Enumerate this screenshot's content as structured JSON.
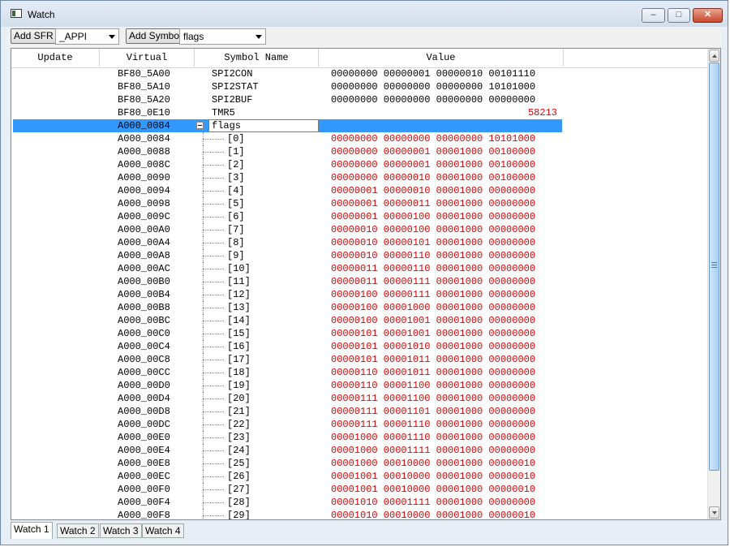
{
  "window": {
    "title": "Watch"
  },
  "toolbar": {
    "add_sfr_label": "Add SFR",
    "sfr_combo_value": "_APPI",
    "add_symbol_label": "Add Symbol",
    "symbol_combo_value": "flags"
  },
  "columns": [
    "Update",
    "Virtual",
    "Symbol Name",
    "Value"
  ],
  "sfr_rows": [
    {
      "virtual": "BF80_5A00",
      "symbol": "SPI2CON",
      "value": "00000000 00000001 00000010 00101110"
    },
    {
      "virtual": "BF80_5A10",
      "symbol": "SPI2STAT",
      "value": "00000000 00000000 00000000 10101000"
    },
    {
      "virtual": "BF80_5A20",
      "symbol": "SPI2BUF",
      "value": "00000000 00000000 00000000 00000000"
    },
    {
      "virtual": "BF80_0E10",
      "symbol": "TMR5",
      "value": "58213"
    }
  ],
  "selected_row": {
    "virtual": "A000_0084",
    "symbol": "flags",
    "value": ""
  },
  "array_rows": [
    {
      "virtual": "A000_0084",
      "index": "[0]",
      "value": "00000000 00000000 00000000 10101000"
    },
    {
      "virtual": "A000_0088",
      "index": "[1]",
      "value": "00000000 00000001 00001000 00100000"
    },
    {
      "virtual": "A000_008C",
      "index": "[2]",
      "value": "00000000 00000001 00001000 00100000"
    },
    {
      "virtual": "A000_0090",
      "index": "[3]",
      "value": "00000000 00000010 00001000 00100000"
    },
    {
      "virtual": "A000_0094",
      "index": "[4]",
      "value": "00000001 00000010 00001000 00000000"
    },
    {
      "virtual": "A000_0098",
      "index": "[5]",
      "value": "00000001 00000011 00001000 00000000"
    },
    {
      "virtual": "A000_009C",
      "index": "[6]",
      "value": "00000001 00000100 00001000 00000000"
    },
    {
      "virtual": "A000_00A0",
      "index": "[7]",
      "value": "00000010 00000100 00001000 00000000"
    },
    {
      "virtual": "A000_00A4",
      "index": "[8]",
      "value": "00000010 00000101 00001000 00000000"
    },
    {
      "virtual": "A000_00A8",
      "index": "[9]",
      "value": "00000010 00000110 00001000 00000000"
    },
    {
      "virtual": "A000_00AC",
      "index": "[10]",
      "value": "00000011 00000110 00001000 00000000"
    },
    {
      "virtual": "A000_00B0",
      "index": "[11]",
      "value": "00000011 00000111 00001000 00000000"
    },
    {
      "virtual": "A000_00B4",
      "index": "[12]",
      "value": "00000100 00000111 00001000 00000000"
    },
    {
      "virtual": "A000_00B8",
      "index": "[13]",
      "value": "00000100 00001000 00001000 00000000"
    },
    {
      "virtual": "A000_00BC",
      "index": "[14]",
      "value": "00000100 00001001 00001000 00000000"
    },
    {
      "virtual": "A000_00C0",
      "index": "[15]",
      "value": "00000101 00001001 00001000 00000000"
    },
    {
      "virtual": "A000_00C4",
      "index": "[16]",
      "value": "00000101 00001010 00001000 00000000"
    },
    {
      "virtual": "A000_00C8",
      "index": "[17]",
      "value": "00000101 00001011 00001000 00000000"
    },
    {
      "virtual": "A000_00CC",
      "index": "[18]",
      "value": "00000110 00001011 00001000 00000000"
    },
    {
      "virtual": "A000_00D0",
      "index": "[19]",
      "value": "00000110 00001100 00001000 00000000"
    },
    {
      "virtual": "A000_00D4",
      "index": "[20]",
      "value": "00000111 00001100 00001000 00000000"
    },
    {
      "virtual": "A000_00D8",
      "index": "[21]",
      "value": "00000111 00001101 00001000 00000000"
    },
    {
      "virtual": "A000_00DC",
      "index": "[22]",
      "value": "00000111 00001110 00001000 00000000"
    },
    {
      "virtual": "A000_00E0",
      "index": "[23]",
      "value": "00001000 00001110 00001000 00000000"
    },
    {
      "virtual": "A000_00E4",
      "index": "[24]",
      "value": "00001000 00001111 00001000 00000000"
    },
    {
      "virtual": "A000_00E8",
      "index": "[25]",
      "value": "00001000 00010000 00001000 00000010"
    },
    {
      "virtual": "A000_00EC",
      "index": "[26]",
      "value": "00001001 00010000 00001000 00000010"
    },
    {
      "virtual": "A000_00F0",
      "index": "[27]",
      "value": "00001001 00010000 00001000 00000010"
    },
    {
      "virtual": "A000_00F4",
      "index": "[28]",
      "value": "00001010 00001111 00001000 00000000"
    },
    {
      "virtual": "A000_00F8",
      "index": "[29]",
      "value": "00001010 00010000 00001000 00000010"
    }
  ],
  "tabs": [
    "Watch 1",
    "Watch 2",
    "Watch 3",
    "Watch 4"
  ],
  "active_tab": "Watch 1",
  "colors": {
    "changed_value": "#e00000",
    "selection": "#3399ff"
  }
}
